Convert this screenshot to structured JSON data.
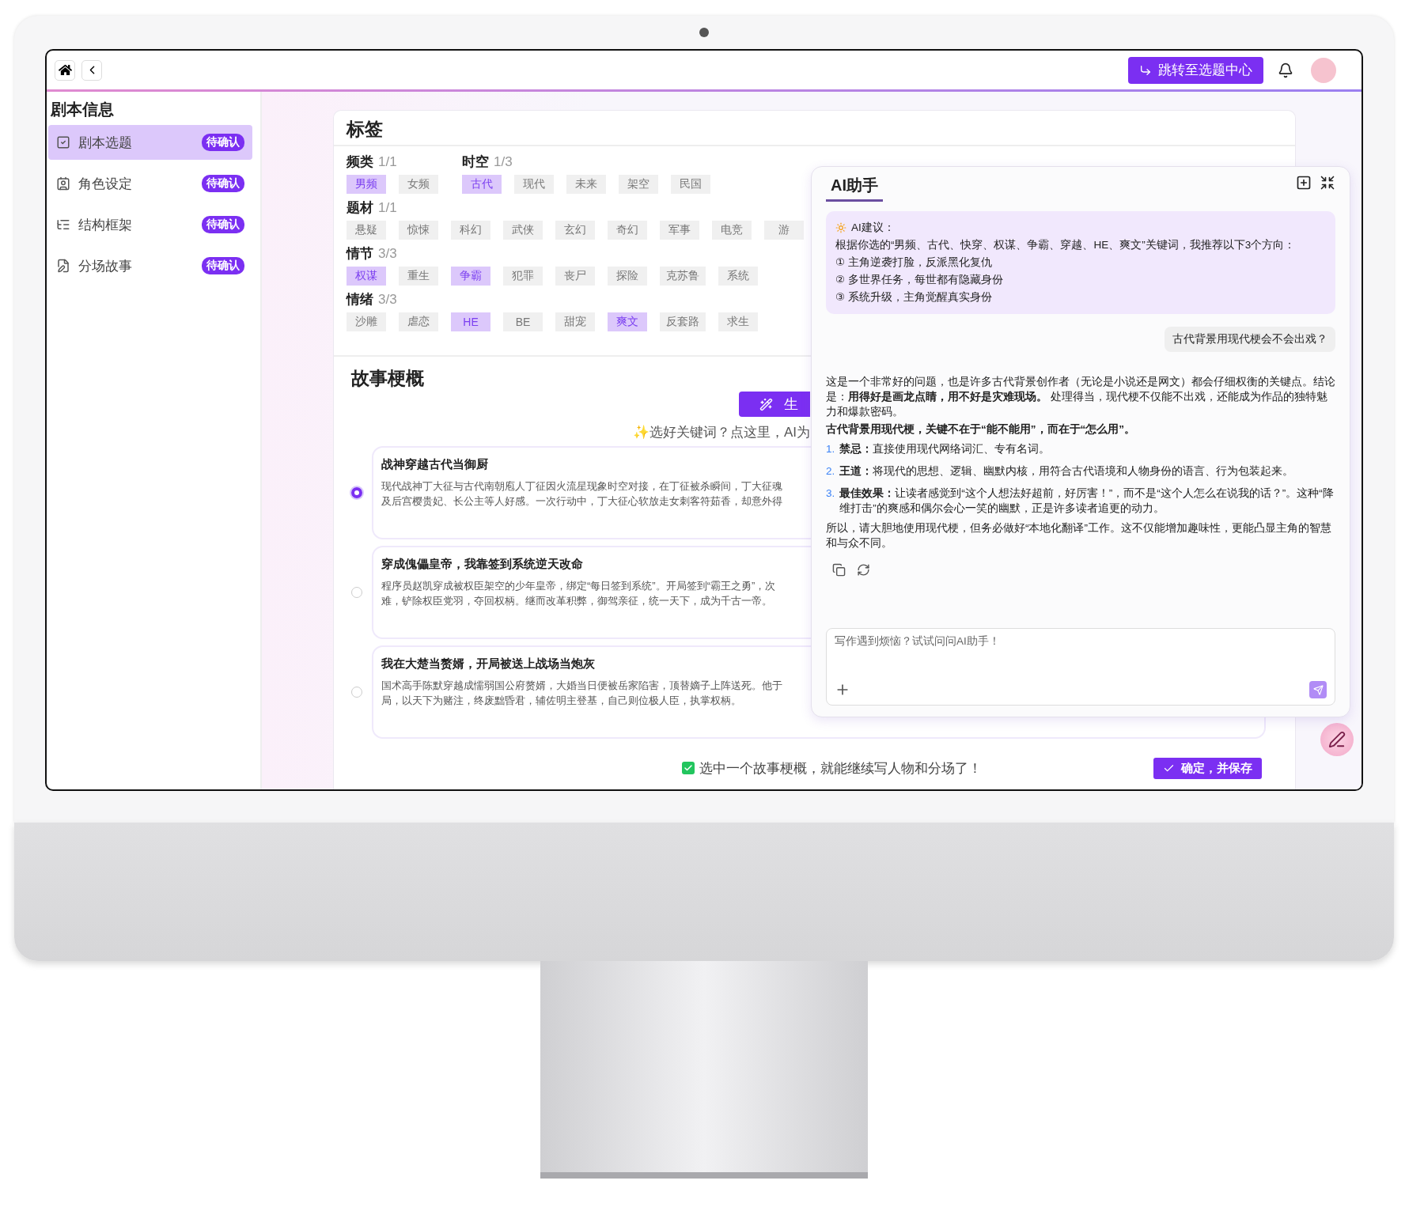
{
  "topbar": {
    "jump_button": "跳转至选题中心"
  },
  "sidebar": {
    "title": "剧本信息",
    "items": [
      {
        "kind": "topic",
        "label": "剧本选题",
        "badge": "待确认",
        "selected": true
      },
      {
        "kind": "character",
        "label": "角色设定",
        "badge": "待确认",
        "selected": false
      },
      {
        "kind": "structure",
        "label": "结构框架",
        "badge": "待确认",
        "selected": false
      },
      {
        "kind": "scene",
        "label": "分场故事",
        "badge": "待确认",
        "selected": false
      }
    ]
  },
  "tags": {
    "title": "标签",
    "lines": [
      {
        "categories": [
          {
            "name": "频类",
            "count": "1/1",
            "tags": [
              {
                "label": "男频",
                "selected": true
              },
              {
                "label": "女频",
                "selected": false
              }
            ]
          },
          {
            "name": "时空",
            "count": "1/3",
            "tags": [
              {
                "label": "古代",
                "selected": true
              },
              {
                "label": "现代",
                "selected": false
              },
              {
                "label": "未来",
                "selected": false
              },
              {
                "label": "架空",
                "selected": false
              },
              {
                "label": "民国",
                "selected": false
              }
            ]
          }
        ]
      },
      {
        "categories": [
          {
            "name": "题材",
            "count": "1/1",
            "tags": [
              {
                "label": "悬疑",
                "selected": false
              },
              {
                "label": "惊悚",
                "selected": false
              },
              {
                "label": "科幻",
                "selected": false
              },
              {
                "label": "武侠",
                "selected": false
              },
              {
                "label": "玄幻",
                "selected": false
              },
              {
                "label": "奇幻",
                "selected": false
              },
              {
                "label": "军事",
                "selected": false
              },
              {
                "label": "电竞",
                "selected": false
              },
              {
                "label": "游",
                "selected": false
              }
            ]
          }
        ]
      },
      {
        "categories": [
          {
            "name": "情节",
            "count": "3/3",
            "tags": [
              {
                "label": "权谋",
                "selected": true
              },
              {
                "label": "重生",
                "selected": false
              },
              {
                "label": "争霸",
                "selected": true
              },
              {
                "label": "犯罪",
                "selected": false
              },
              {
                "label": "丧尸",
                "selected": false
              },
              {
                "label": "探险",
                "selected": false
              },
              {
                "label": "克苏鲁",
                "selected": false
              },
              {
                "label": "系统",
                "selected": false
              }
            ]
          }
        ]
      },
      {
        "categories": [
          {
            "name": "情绪",
            "count": "3/3",
            "tags": [
              {
                "label": "沙雕",
                "selected": false
              },
              {
                "label": "虐恋",
                "selected": false
              },
              {
                "label": "HE",
                "selected": true
              },
              {
                "label": "BE",
                "selected": false
              },
              {
                "label": "甜宠",
                "selected": false
              },
              {
                "label": "爽文",
                "selected": true
              },
              {
                "label": "反套路",
                "selected": false
              },
              {
                "label": "求生",
                "selected": false
              }
            ]
          }
        ]
      }
    ]
  },
  "story": {
    "title": "故事梗概",
    "generate_button": "生",
    "hint": "✨选好关键词？点这里，AI为",
    "options": [
      {
        "title": "战神穿越古代当御厨",
        "lines": [
          "现代战神丁大征与古代南朝庖人丁征因火流星现象时空对接，在丁征被杀瞬间，丁大征魂",
          "及后宫樱贵妃、长公主等人好感。一次行动中，丁大征心软放走女刺客符茹香，却意外得"
        ],
        "selected": true
      },
      {
        "title": "穿成傀儡皇帝，我靠签到系统逆天改命",
        "lines": [
          "程序员赵凯穿成被权臣架空的少年皇帝，绑定“每日签到系统”。开局签到“霸王之勇”，次",
          "难，铲除权臣党羽，夺回权柄。继而改革积弊，御驾亲征，统一天下，成为千古一帝。"
        ],
        "selected": false
      },
      {
        "title": "我在大楚当赘婿，开局被送上战场当炮灰",
        "lines": [
          "国术高手陈默穿越成懦弱国公府赘婿，大婚当日便被岳家陷害，顶替嫡子上阵送死。他于",
          "局，以天下为赌注，终废黜昏君，辅佐明主登基，自己则位极人臣，执掌权柄。"
        ],
        "selected": false
      }
    ],
    "footer_checked": true,
    "footer_note": "选中一个故事梗概，就能继续写人物和分场了！",
    "confirm_button": "确定，并保存"
  },
  "ai_panel": {
    "title": "AI助手",
    "suggestion": {
      "label": "AI建议：",
      "intro": "根据你选的“男频、古代、快穿、权谋、争霸、穿越、HE、爽文”关键词，我推荐以下3个方向：",
      "items": [
        "① 主角逆袭打脸，反派黑化复仇",
        "② 多世界任务，每世都有隐藏身份",
        "③ 系统升级，主角觉醒真实身份"
      ]
    },
    "user_message": "古代背景用现代梗会不会出戏？",
    "answer": [
      {
        "kind": "paragraph",
        "text": "这是一个非常好的问题，也是许多古代背景创作者（无论是小说还是网文）都会仔细权衡的关键点。结论是：**用得好是画龙点睛，用不好是灾难现场。** 处理得当，现代梗不仅能不出戏，还能成为作品的独特魅力和爆款密码。"
      },
      {
        "kind": "heading",
        "text": "古代背景用现代梗，关键不在于“能不能用”，而在于“怎么用”。"
      },
      {
        "kind": "item",
        "number": "1.",
        "text": "**禁忌：**直接使用现代网络词汇、专有名词。"
      },
      {
        "kind": "item",
        "number": "2.",
        "text": "**王道：**将现代的思想、逻辑、幽默内核，用符合古代语境和人物身份的语言、行为包装起来。"
      },
      {
        "kind": "item",
        "number": "3.",
        "text": "**最佳效果：**让读者感觉到“这个人想法好超前，好厉害！”，而不是“这个人怎么在说我的话？”。这种“降维打击”的爽感和偶尔会心一笑的幽默，正是许多读者追更的动力。"
      },
      {
        "kind": "paragraph",
        "text": "所以，请大胆地使用现代梗，但务必做好“本地化翻译”工作。这不仅能增加趣味性，更能凸显主角的智慧和与众不同。"
      }
    ],
    "input": {
      "placeholder": "写作遇到烦恼？试试问问AI助手！"
    }
  }
}
